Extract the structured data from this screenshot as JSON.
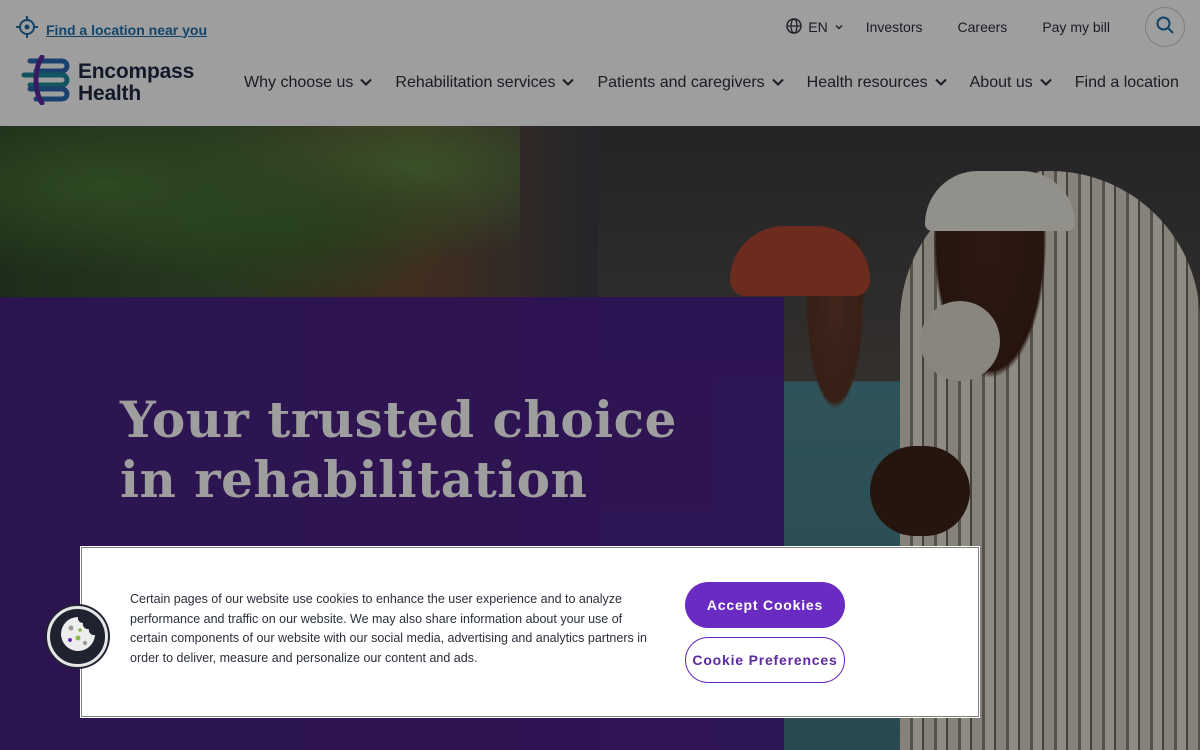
{
  "utility": {
    "find_location": "Find a location near you",
    "language": "EN",
    "links": [
      "Investors",
      "Careers",
      "Pay my bill"
    ]
  },
  "logo": {
    "line1": "Encompass",
    "line2": "Health"
  },
  "nav": [
    "Why choose us",
    "Rehabilitation services",
    "Patients and caregivers",
    "Health resources",
    "About us",
    "Find a location"
  ],
  "hero": {
    "title": "Your trusted choice in rehabilitation"
  },
  "cookie": {
    "text": "Certain pages of our website use cookies to enhance the user experience and to analyze performance and traffic on our website. We may also share information about your use of certain components of our website with our social media, advertising and analytics partners in order to deliver, measure and personalize our content and ads.",
    "accept": "Accept Cookies",
    "preferences": "Cookie Preferences"
  },
  "colors": {
    "brand_purple": "#4a1e8a",
    "button_purple": "#6a2bc2",
    "link_blue": "#1f6fa8"
  }
}
